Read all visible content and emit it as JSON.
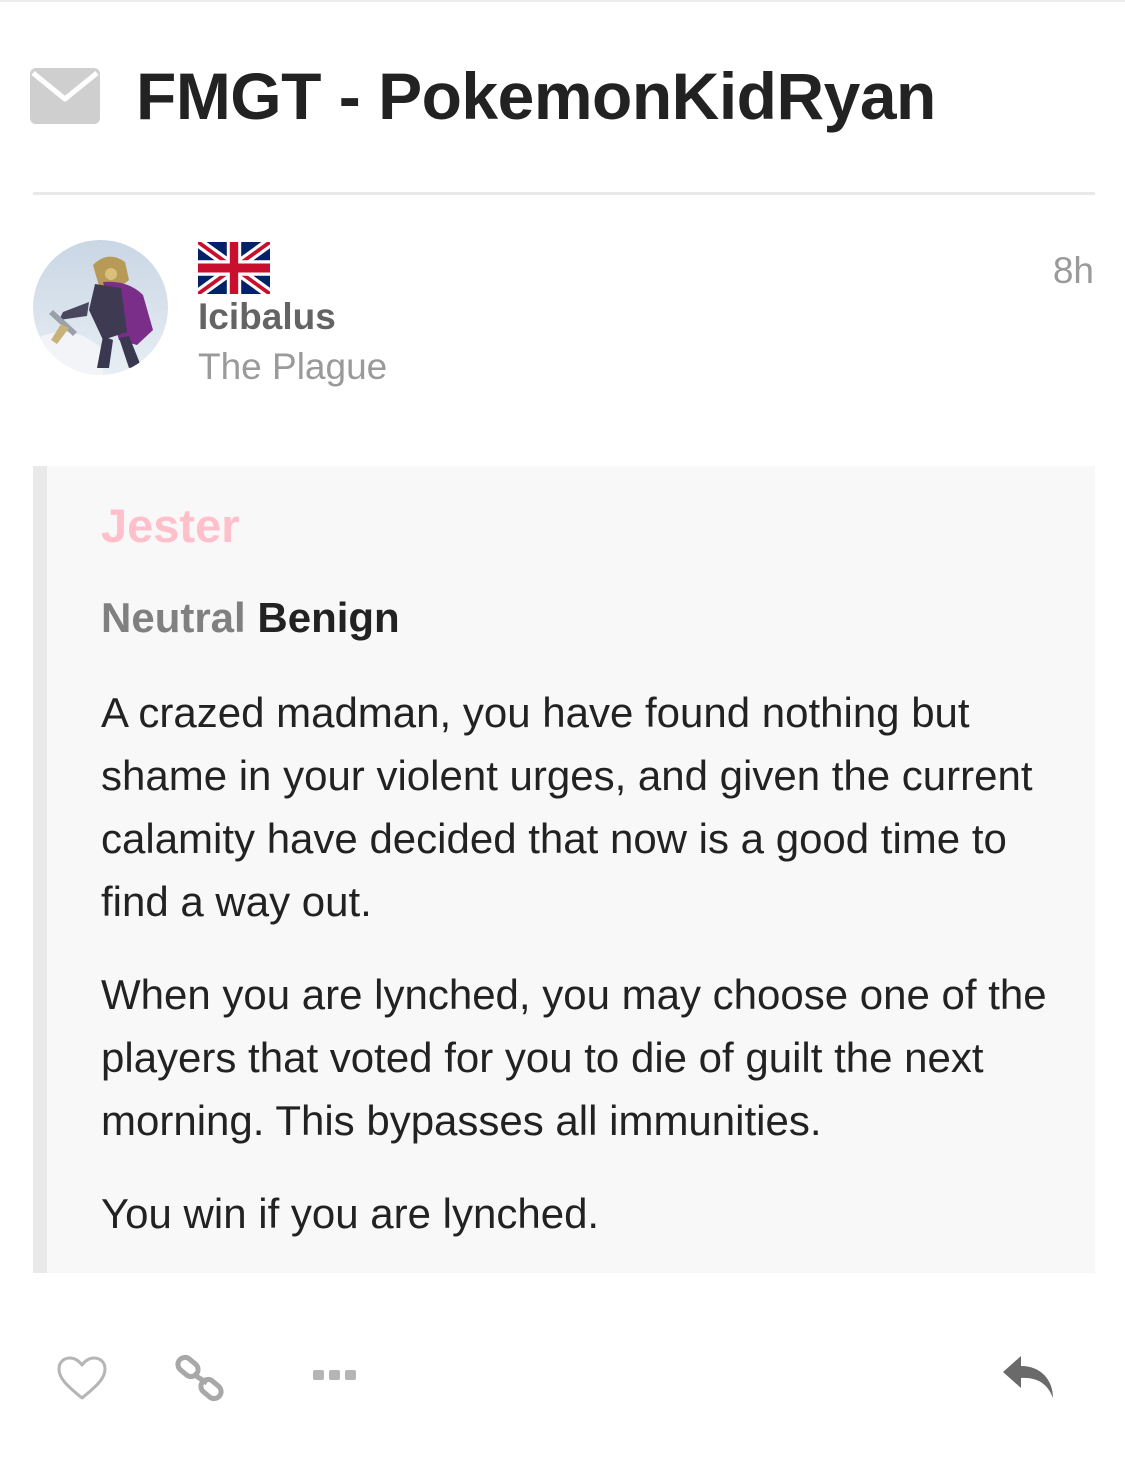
{
  "topic": {
    "title": "FMGT - PokemonKidRyan",
    "icon": "envelope-icon"
  },
  "post": {
    "author": {
      "username": "Icibalus",
      "title": "The Plague",
      "flag": "united-kingdom-flag",
      "avatar": "avatar"
    },
    "time": "8h",
    "quote": {
      "role_name": "Jester",
      "role_color": "#ffc0cb",
      "faction": "Neutral",
      "faction_color": "#808080",
      "alignment": "Benign",
      "paragraphs": [
        "A crazed madman, you have found nothing but shame in your violent urges, and given the current calamity have decided that now is a good time to find a way out.",
        "When you are lynched, you may choose one of the players that voted for you to die of guilt the next morning. This bypasses all immunities.",
        "You win if you are lynched."
      ]
    },
    "actions": {
      "like_icon": "heart-icon",
      "link_icon": "link-icon",
      "more_icon": "ellipsis-icon",
      "reply_icon": "reply-icon"
    }
  }
}
